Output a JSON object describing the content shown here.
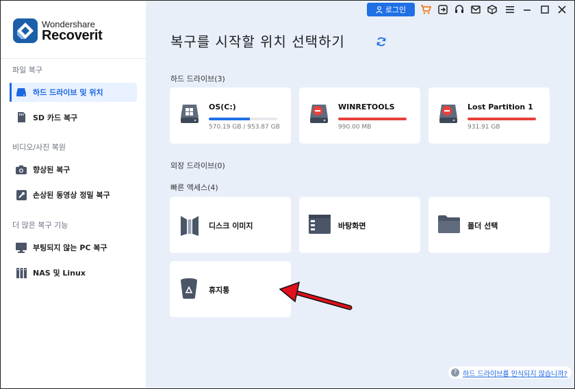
{
  "app": {
    "brand_line1": "Wondershare",
    "brand_line2": "Recoverit"
  },
  "sidebar": {
    "sections": [
      {
        "label": "파일 복구"
      },
      {
        "label": "비디오/사진 복원"
      },
      {
        "label": "더 많은 복구 기능"
      }
    ],
    "items": [
      {
        "label": "하드 드라이브 및 위치",
        "icon": "hard-drive-icon",
        "active": true
      },
      {
        "label": "SD 카드 복구",
        "icon": "sd-card-icon"
      },
      {
        "label": "향상된 복구",
        "icon": "camera-icon"
      },
      {
        "label": "손상된 동영상 정밀 복구",
        "icon": "video-repair-icon"
      },
      {
        "label": "부팅되지 않는 PC 복구",
        "icon": "monitor-icon"
      },
      {
        "label": "NAS 및 Linux",
        "icon": "nas-icon"
      }
    ]
  },
  "topbar": {
    "login_label": "로그인",
    "icons": [
      "cart-icon",
      "sign-in-icon",
      "headset-icon",
      "mail-icon",
      "cube-icon",
      "menu-icon",
      "minimize-icon",
      "maximize-icon",
      "close-icon"
    ]
  },
  "main": {
    "title": "복구를 시작할 위치 선택하기",
    "hard_drives_label": "하드 드라이브(3)",
    "external_label": "외장 드라이브(0)",
    "quick_access_label": "빠른 액세스(4)",
    "drives": [
      {
        "name": "OS(C:)",
        "size": "570.19 GB / 953.87 GB",
        "used_fraction": 0.6,
        "bar_color": "#1f6fe5",
        "icon": "windows-drive-icon"
      },
      {
        "name": "WINRETOOLS",
        "size": "990.00 MB",
        "used_fraction": 1.0,
        "bar_color": "#e8403a",
        "icon": "error-drive-icon"
      },
      {
        "name": "Lost Partition 1",
        "size": "931.91 GB",
        "used_fraction": 1.0,
        "bar_color": "#e8403a",
        "icon": "error-drive-icon"
      }
    ],
    "quick": [
      {
        "label": "디스크 이미지",
        "icon": "disk-image-icon"
      },
      {
        "label": "바탕화면",
        "icon": "desktop-icon"
      },
      {
        "label": "폴더 선택",
        "icon": "folder-icon"
      },
      {
        "label": "휴지통",
        "icon": "recycle-bin-icon"
      }
    ]
  },
  "help_text": "하드 드라이브를 인식되지 않습니까?",
  "colors": {
    "accent": "#1f6fe5",
    "error": "#e8403a",
    "main_bg": "#e9eff9",
    "arrow": "#e0101c"
  }
}
